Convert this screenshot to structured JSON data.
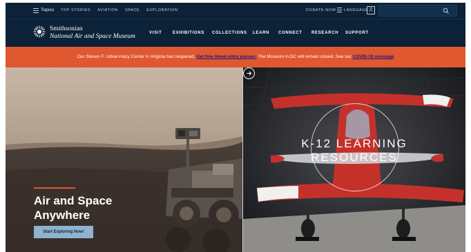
{
  "topbar": {
    "topics_label": "Topics",
    "links": [
      "TOP STORIES",
      "AVIATION",
      "SPACE",
      "EXPLORATION"
    ],
    "donate_label": "DONATE NOW",
    "language_label": "LANGUAGE",
    "menu_icon": "hamburger-icon",
    "search_icon": "search-icon",
    "translate_icon": "translate-icon"
  },
  "header": {
    "logo_line1": "Smithsonian",
    "logo_line2": "National Air and Space Museum",
    "nav": [
      "VISIT",
      "EXHIBITIONS",
      "COLLECTIONS",
      "LEARN",
      "CONNECT",
      "RESEARCH",
      "SUPPORT"
    ]
  },
  "alert": {
    "text_before": "Our Steven F. Udvar-Hazy Center in Virginia has reopened.",
    "link1": "Get free timed entry passes.",
    "text_middle": "The Museum in DC will remain closed. See our",
    "link2": "COVID-19 message"
  },
  "hero_left": {
    "title_line1": "Air and Space",
    "title_line2": "Anywhere",
    "cta_label": "Start Exploring Now!"
  },
  "hero_right": {
    "title_line1": "K-12 LEARNING",
    "title_line2": "RESOURCES",
    "arrow_icon": "arrow-right-circle-icon"
  },
  "colors": {
    "navy": "#0b2238",
    "accent": "#e0582f",
    "cta": "#8fb3cf",
    "link": "#1c1780"
  }
}
